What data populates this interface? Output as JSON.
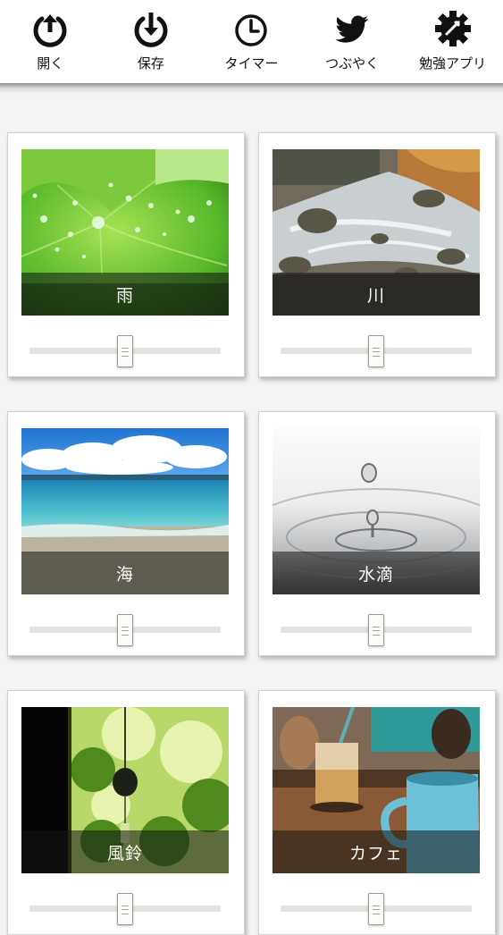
{
  "toolbar": {
    "items": [
      {
        "label": "開く",
        "icon": "open-icon"
      },
      {
        "label": "保存",
        "icon": "save-icon"
      },
      {
        "label": "タイマー",
        "icon": "timer-icon"
      },
      {
        "label": "つぶやく",
        "icon": "twitter-icon"
      },
      {
        "label": "勉強アプリ",
        "icon": "gear-icon"
      }
    ]
  },
  "sounds": [
    {
      "label": "雨",
      "volume": 0.5
    },
    {
      "label": "川",
      "volume": 0.5
    },
    {
      "label": "海",
      "volume": 0.5
    },
    {
      "label": "水滴",
      "volume": 0.5
    },
    {
      "label": "風鈴",
      "volume": 0.5
    },
    {
      "label": "カフェ",
      "volume": 0.5
    }
  ],
  "colors": {
    "toolbar_bg": "#ffffff",
    "page_bg": "#f4f4f6",
    "icon": "#111111"
  }
}
